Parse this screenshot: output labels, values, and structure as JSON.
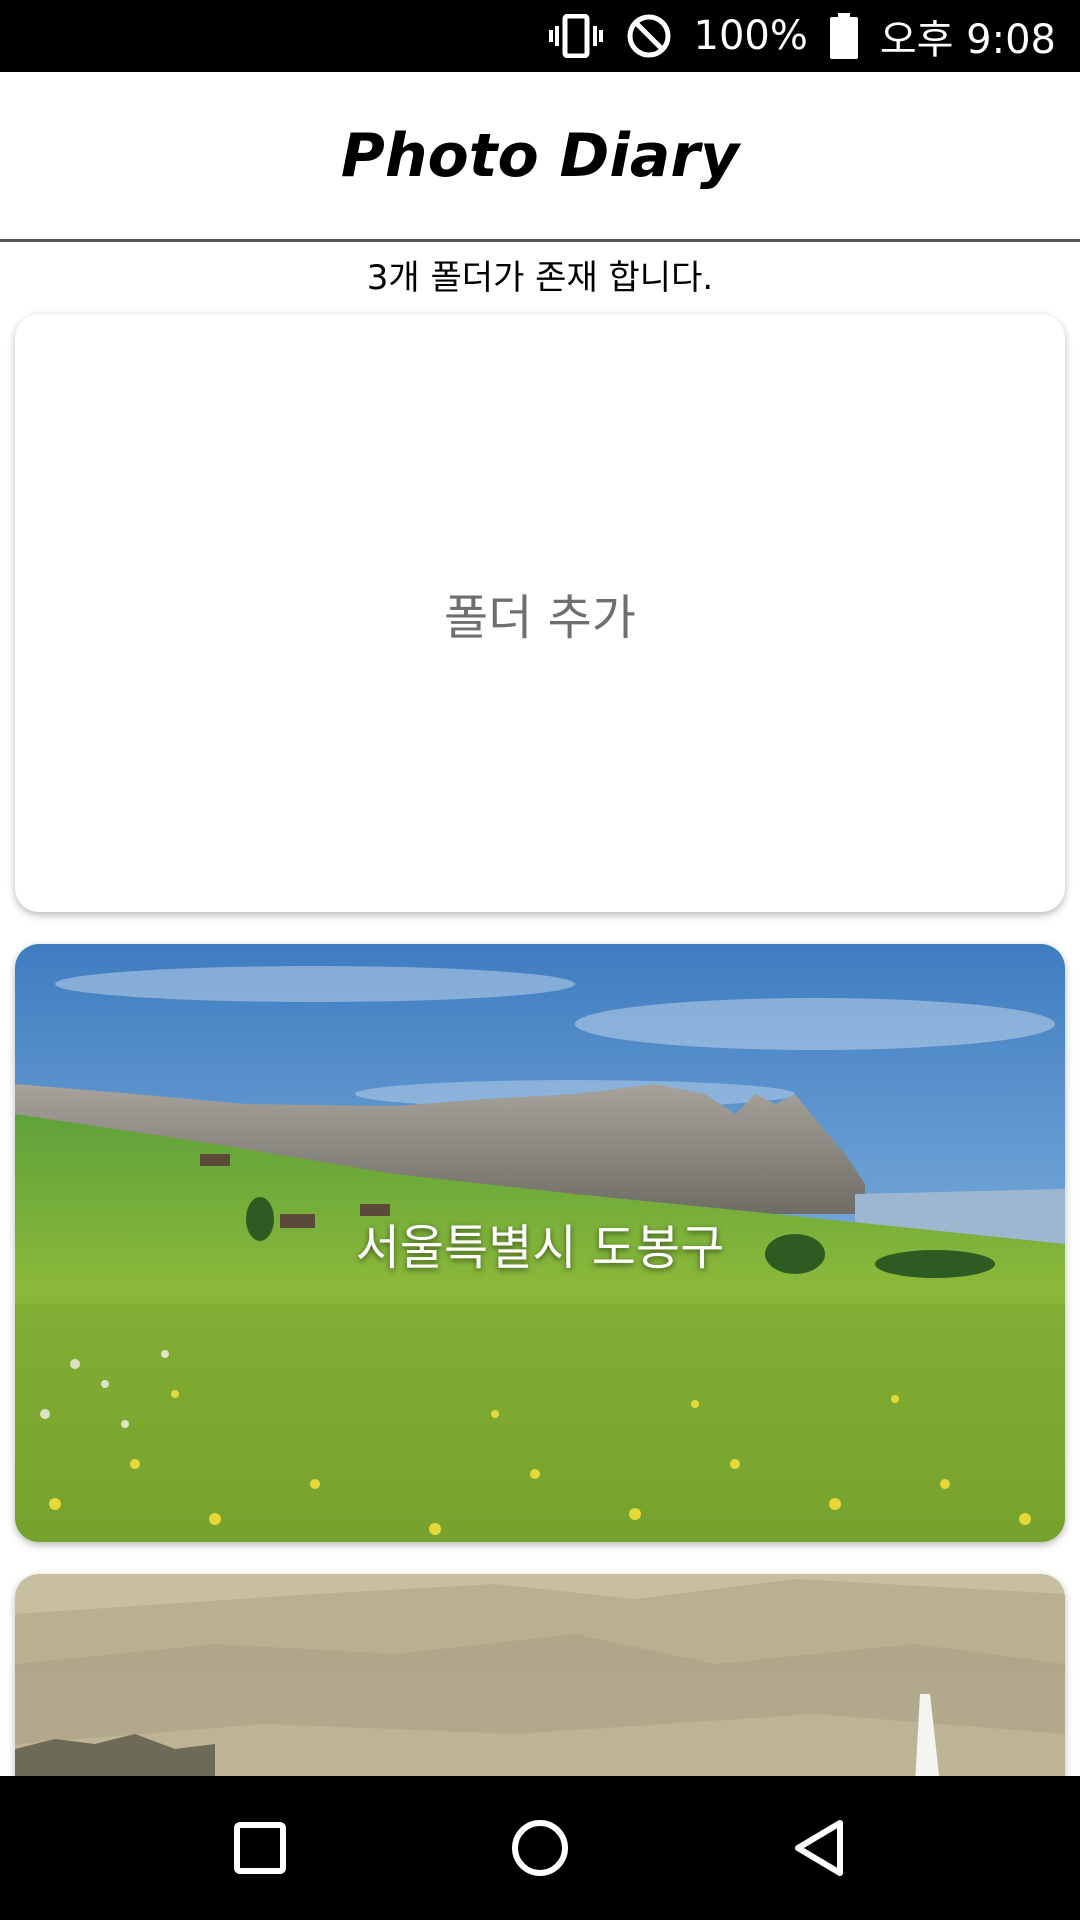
{
  "status_bar": {
    "battery": "100%",
    "time": "오후 9:08",
    "icons": [
      "vibrate-icon",
      "do-not-disturb-icon",
      "battery-icon"
    ]
  },
  "app_bar": {
    "title": "Photo Diary"
  },
  "folder_count_text": "3개 폴더가 존재 합니다.",
  "cards": [
    {
      "label": "폴더 추가"
    },
    {
      "label": "서울특별시 도봉구"
    },
    {
      "label": ""
    }
  ],
  "nav_bar": {
    "icons": [
      "recents-square-icon",
      "home-circle-icon",
      "back-triangle-icon"
    ]
  }
}
